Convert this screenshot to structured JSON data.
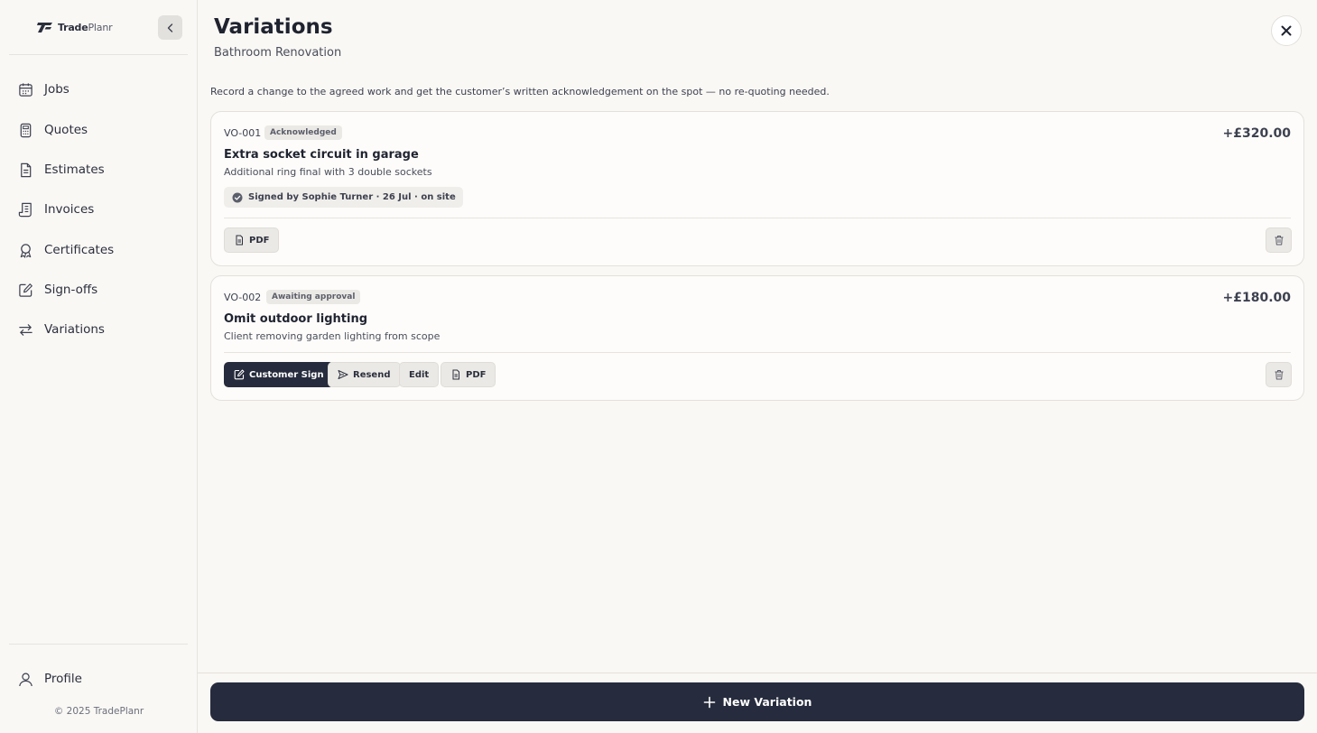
{
  "brand": {
    "name_bold": "Trade",
    "name_light": "Planr"
  },
  "sidebar": {
    "items": [
      {
        "label": "Jobs",
        "icon": "calendar-icon"
      },
      {
        "label": "Quotes",
        "icon": "calculator-icon"
      },
      {
        "label": "Estimates",
        "icon": "document-icon"
      },
      {
        "label": "Invoices",
        "icon": "receipt-icon"
      },
      {
        "label": "Certificates",
        "icon": "award-icon"
      },
      {
        "label": "Sign-offs",
        "icon": "pen-square-icon"
      },
      {
        "label": "Variations",
        "icon": "arrows-swap-icon"
      }
    ],
    "profile_label": "Profile",
    "copyright": "© 2025 TradePlanr"
  },
  "header": {
    "title": "Variations",
    "subtitle": "Bathroom Renovation"
  },
  "intro": "Record a change to the agreed work and get the customer’s written acknowledgement on the spot — no re-quoting needed.",
  "variations": [
    {
      "ref": "VO-001",
      "status": "Acknowledged",
      "amount": "+£320.00",
      "title": "Extra socket circuit in garage",
      "description": "Additional ring final with 3 double sockets",
      "signed": "Signed by Sophie Turner · 26 Jul · on site",
      "actions": {
        "pdf": "PDF"
      }
    },
    {
      "ref": "VO-002",
      "status": "Awaiting approval",
      "amount": "+£180.00",
      "title": "Omit outdoor lighting",
      "description": "Client removing garden lighting from scope",
      "actions": {
        "customer_sign": "Customer Sign",
        "resend": "Resend",
        "edit": "Edit",
        "pdf": "PDF"
      }
    }
  ],
  "footer": {
    "new_variation": "New Variation"
  },
  "colors": {
    "primary": "#262c3d",
    "background": "#faf8f5",
    "badge": "#ebe9e5"
  }
}
